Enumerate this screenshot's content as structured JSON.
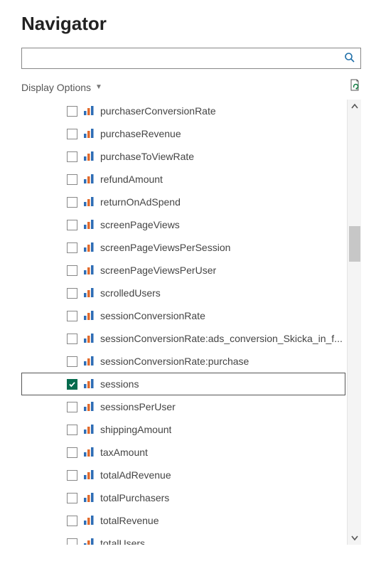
{
  "title": "Navigator",
  "search": {
    "value": "",
    "placeholder": ""
  },
  "toolbar": {
    "display_options_label": "Display Options"
  },
  "items": [
    {
      "label": "purchaserConversionRate",
      "checked": false,
      "selected": false
    },
    {
      "label": "purchaseRevenue",
      "checked": false,
      "selected": false
    },
    {
      "label": "purchaseToViewRate",
      "checked": false,
      "selected": false
    },
    {
      "label": "refundAmount",
      "checked": false,
      "selected": false
    },
    {
      "label": "returnOnAdSpend",
      "checked": false,
      "selected": false
    },
    {
      "label": "screenPageViews",
      "checked": false,
      "selected": false
    },
    {
      "label": "screenPageViewsPerSession",
      "checked": false,
      "selected": false
    },
    {
      "label": "screenPageViewsPerUser",
      "checked": false,
      "selected": false
    },
    {
      "label": "scrolledUsers",
      "checked": false,
      "selected": false
    },
    {
      "label": "sessionConversionRate",
      "checked": false,
      "selected": false
    },
    {
      "label": "sessionConversionRate:ads_conversion_Skicka_in_f...",
      "checked": false,
      "selected": false
    },
    {
      "label": "sessionConversionRate:purchase",
      "checked": false,
      "selected": false
    },
    {
      "label": "sessions",
      "checked": true,
      "selected": true
    },
    {
      "label": "sessionsPerUser",
      "checked": false,
      "selected": false
    },
    {
      "label": "shippingAmount",
      "checked": false,
      "selected": false
    },
    {
      "label": "taxAmount",
      "checked": false,
      "selected": false
    },
    {
      "label": "totalAdRevenue",
      "checked": false,
      "selected": false
    },
    {
      "label": "totalPurchasers",
      "checked": false,
      "selected": false
    },
    {
      "label": "totalRevenue",
      "checked": false,
      "selected": false
    },
    {
      "label": "totalUsers",
      "checked": false,
      "selected": false
    }
  ]
}
